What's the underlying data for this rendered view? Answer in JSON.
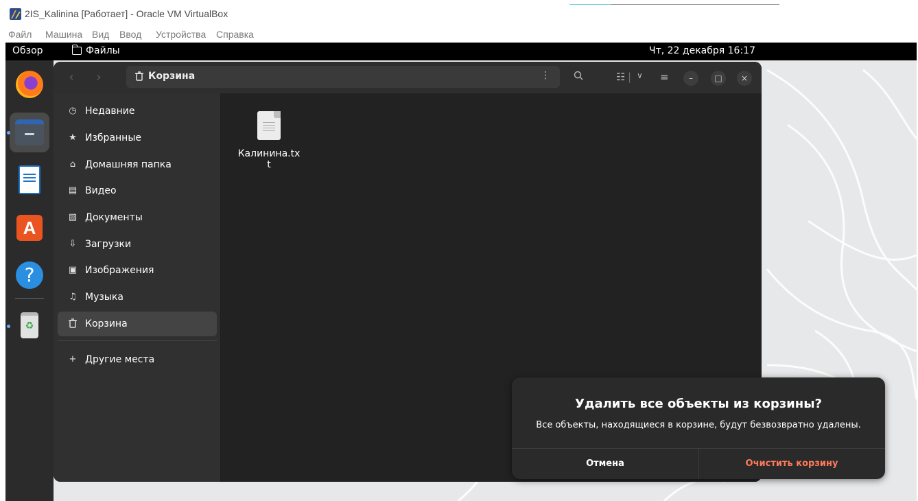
{
  "host": {
    "title": "2IS_Kalinina [Работает] - Oracle VM VirtualBox",
    "menu": [
      "Файл",
      "Машина",
      "Вид",
      "Ввод",
      "Устройства",
      "Справка"
    ]
  },
  "topbar": {
    "overview": "Обзор",
    "app_name": "Файлы",
    "clock": "Чт, 22 декабря  16:17"
  },
  "dock": {
    "items": [
      "firefox-icon",
      "files-icon",
      "writer-icon",
      "app-center-icon",
      "help-icon",
      "trash-icon"
    ]
  },
  "window": {
    "path_title": "Корзина"
  },
  "sidebar": {
    "items": [
      {
        "label": "Недавние",
        "icon": "clock-icon"
      },
      {
        "label": "Избранные",
        "icon": "star-icon"
      },
      {
        "label": "Домашняя папка",
        "icon": "home-icon"
      },
      {
        "label": "Видео",
        "icon": "film-icon"
      },
      {
        "label": "Документы",
        "icon": "document-icon"
      },
      {
        "label": "Загрузки",
        "icon": "download-icon"
      },
      {
        "label": "Изображения",
        "icon": "image-icon"
      },
      {
        "label": "Музыка",
        "icon": "music-icon"
      },
      {
        "label": "Корзина",
        "icon": "trash-icon",
        "selected": true
      }
    ],
    "other_places": "Другие места"
  },
  "content": {
    "files": [
      {
        "name": "Калинина.txt",
        "icon": "text-file-icon"
      }
    ]
  },
  "dialog": {
    "title": "Удалить все объекты из корзины?",
    "body": "Все объекты, находящиеся в корзине, будут безвозвратно удалены.",
    "cancel_label": "Отмена",
    "confirm_label": "Очистить корзину"
  },
  "colors": {
    "accent_destructive": "#ff7a5c",
    "dock_background": "#2b2b2b",
    "window_background": "#242424"
  }
}
